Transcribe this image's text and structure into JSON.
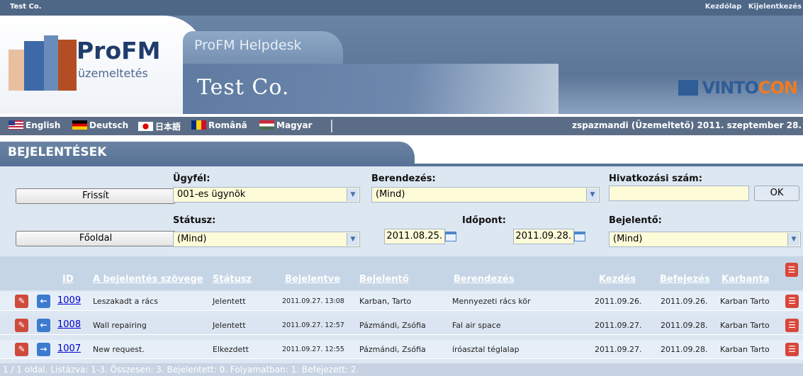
{
  "top": {
    "company": "Test Co.",
    "links": [
      "Kezdólap",
      "Kijelentkezés"
    ]
  },
  "banner": {
    "logo_title": "ProFM",
    "logo_subtitle": "üzemeltetés",
    "app_tab": "ProFM Helpdesk",
    "client_name": "Test Co.",
    "brand_left": "VINTO",
    "brand_right": "CON"
  },
  "languages": [
    "English",
    "Deutsch",
    "日本語",
    "Română",
    "Magyar"
  ],
  "user_info": "zspazmandi (Üzemeltető) 2011. szeptember 28.",
  "section_title": "BEJELENTÉSEK",
  "filters": {
    "refresh_button": "Frissít",
    "home_button": "Főoldal",
    "client_label": "Ügyfél:",
    "client_value": "001-es ügynök",
    "device_label": "Berendezés:",
    "device_value": "(Mind)",
    "ref_label": "Hivatkozási szám:",
    "ref_value": "",
    "ok_button": "OK",
    "status_label": "Státusz:",
    "status_value": "(Mind)",
    "time_label": "Időpont:",
    "date_from": "2011.08.25.",
    "date_to": "2011.09.28.",
    "reporter_label": "Bejelentő:",
    "reporter_value": "(Mind)"
  },
  "table": {
    "headers": {
      "id": "ID",
      "text": "A bejelentés szövege",
      "status": "Státusz",
      "reported": "Bejelentve",
      "reporter": "Bejelentő",
      "device": "Berendezés",
      "start": "Kezdés",
      "end": "Befejezés",
      "maintainer": "Karbanta"
    },
    "rows": [
      {
        "id": "1009",
        "text": "Leszakadt a rács",
        "status": "Jelentett",
        "reported": "2011.09.27. 13:08",
        "reporter": "Karban, Tarto",
        "device": "Mennyezeti rács kör",
        "start": "2011.09.26.",
        "end": "2011.09.26.",
        "maintainer": "Karban Tarto",
        "action_icon": "arrow-left-icon"
      },
      {
        "id": "1008",
        "text": "Wall repairing",
        "status": "Jelentett",
        "reported": "2011.09.27. 12:57",
        "reporter": "Pázmándi, Zsófia",
        "device": "Fal air space",
        "start": "2011.09.27.",
        "end": "2011.09.28.",
        "maintainer": "Karban Tarto",
        "action_icon": "arrow-left-icon"
      },
      {
        "id": "1007",
        "text": "New request.",
        "status": "Elkezdett",
        "reported": "2011.09.27. 12:55",
        "reporter": "Pázmándi, Zsófia",
        "device": "íróasztal téglalap",
        "start": "2011.09.27.",
        "end": "2011.09.28.",
        "maintainer": "Karban Tarto",
        "action_icon": "arrow-right-icon"
      }
    ]
  },
  "footer": "1 / 1 oldal. Listázva: 1-3. Összesen: 3. Bejelentett: 0. Folyamatban: 1. Befejezett: 2.",
  "colors": {
    "header_blue": "#5b6d86",
    "panel_bg": "#dde7f2",
    "input_bg": "#fdfbd8",
    "link": "#0000cc",
    "edit_icon": "#cf4a3c",
    "arrow_icon": "#3b7bd0"
  }
}
